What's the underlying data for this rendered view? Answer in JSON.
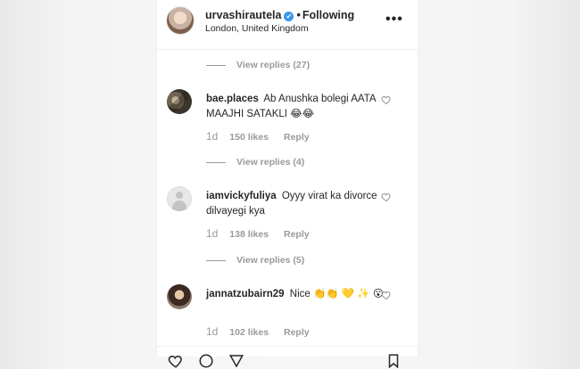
{
  "header": {
    "username": "urvashirautela",
    "verified_mark": "✔",
    "separator": "•",
    "follow_status": "Following",
    "location": "London, United Kingdom",
    "more_icon": "more-dots-icon"
  },
  "threads": [
    {
      "view_replies": "View replies (27)"
    },
    {
      "view_replies": "View replies (4)"
    },
    {
      "view_replies": "View replies (5)"
    }
  ],
  "comments": [
    {
      "username": "bae.places",
      "text": "Ab Anushka bolegi AATA MAAJHI SATAKLI 😂😂",
      "time": "1d",
      "likes": "150 likes",
      "reply": "Reply"
    },
    {
      "username": "iamvickyfuliya",
      "text": "Oyyy virat ka divorce dilvayegi kya",
      "time": "1d",
      "likes": "138 likes",
      "reply": "Reply"
    },
    {
      "username": "jannatzubairn29",
      "text": "Nice 👏👏 💛 ✨ 😮",
      "time": "1d",
      "likes": "102 likes",
      "reply": "Reply"
    }
  ],
  "footer_icons": [
    "heart-icon",
    "comment-icon",
    "share-icon",
    "bookmark-icon"
  ],
  "colors": {
    "text": "#262626",
    "muted": "#999999",
    "verified": "#3897f0",
    "border": "#efefef"
  }
}
